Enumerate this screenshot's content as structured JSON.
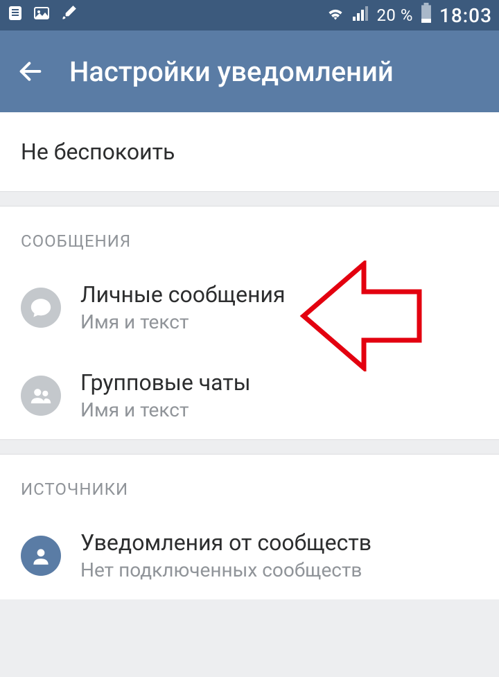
{
  "status_bar": {
    "battery_percent": "20 %",
    "time": "18:03"
  },
  "header": {
    "title": "Настройки уведомлений"
  },
  "dnd": {
    "label": "Не беспокоить"
  },
  "sections": {
    "messages": {
      "header": "СООБЩЕНИЯ",
      "items": [
        {
          "title": "Личные сообщения",
          "subtitle": "Имя и текст"
        },
        {
          "title": "Групповые чаты",
          "subtitle": "Имя и текст"
        }
      ]
    },
    "sources": {
      "header": "ИСТОЧНИКИ",
      "items": [
        {
          "title": "Уведомления от сообществ",
          "subtitle": "Нет подключенных сообществ"
        }
      ]
    }
  }
}
